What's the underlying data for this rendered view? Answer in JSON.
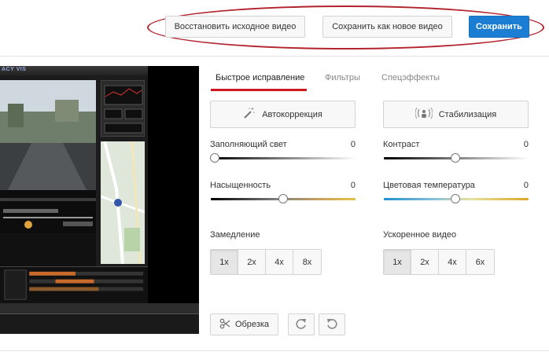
{
  "toolbar": {
    "restore_label": "Восстановить исходное видео",
    "save_as_new_label": "Сохранить как новое видео",
    "save_label": "Сохранить"
  },
  "video_preview": {
    "app_logo": "ACY VIS"
  },
  "tabs": [
    {
      "label": "Быстрое исправление",
      "active": true
    },
    {
      "label": "Фильтры",
      "active": false
    },
    {
      "label": "Спецэффекты",
      "active": false
    }
  ],
  "actions": {
    "autocorrect_label": "Автокоррекция",
    "stabilize_label": "Стабилизация"
  },
  "sliders": {
    "fill_light": {
      "label": "Заполняющий свет",
      "value": "0",
      "level": 0
    },
    "contrast": {
      "label": "Контраст",
      "value": "0",
      "level": 0.5
    },
    "saturation": {
      "label": "Насыщенность",
      "value": "0",
      "level": 0.5
    },
    "color_temperature": {
      "label": "Цветовая температура",
      "value": "0",
      "level": 0.5
    }
  },
  "slow_motion": {
    "label": "Замедление",
    "options": [
      "1x",
      "2x",
      "4x",
      "8x"
    ],
    "selected": "1x"
  },
  "timelapse": {
    "label": "Ускоренное видео",
    "options": [
      "1x",
      "2x",
      "4x",
      "6x"
    ],
    "selected": "1x"
  },
  "tools": {
    "trim_label": "Обрезка"
  },
  "colors": {
    "primary": "#1b7ed3",
    "tab_underline": "#cc181e",
    "highlight": "#b3232e"
  }
}
